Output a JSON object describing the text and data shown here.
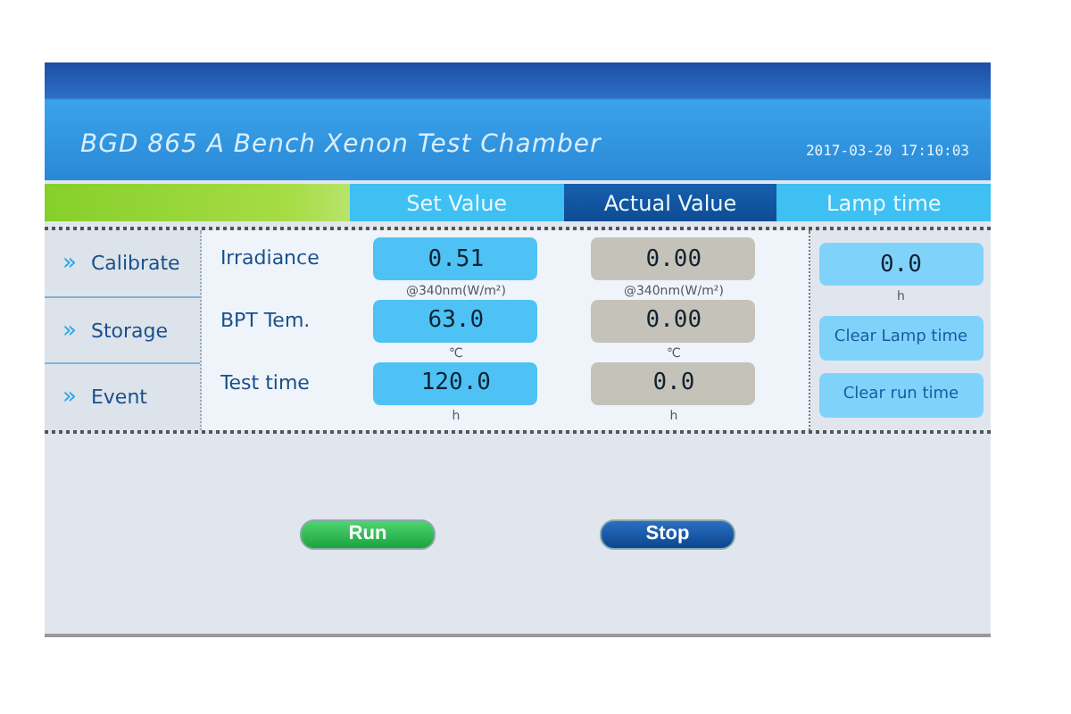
{
  "header": {
    "title": "BGD 865 A  Bench Xenon Test Chamber",
    "datetime": "2017-03-20 17:10:03"
  },
  "tabs": [
    {
      "label": "Set Value",
      "selected": false
    },
    {
      "label": "Actual Value",
      "selected": true
    },
    {
      "label": "Lamp time",
      "selected": false
    }
  ],
  "sidebar": {
    "items": [
      {
        "icon": "»",
        "label": "Calibrate"
      },
      {
        "icon": "»",
        "label": "Storage"
      },
      {
        "icon": "»",
        "label": "Event"
      }
    ]
  },
  "rows": [
    {
      "label": "Irradiance",
      "set_value": "0.51",
      "set_unit": "@340nm(W/m²)",
      "actual_value": "0.00",
      "actual_unit": "@340nm(W/m²)"
    },
    {
      "label": "BPT Tem.",
      "set_value": "63.0",
      "set_unit": "℃",
      "actual_value": "0.00",
      "actual_unit": "℃"
    },
    {
      "label": "Test time",
      "set_value": "120.0",
      "set_unit": "h",
      "actual_value": "0.0",
      "actual_unit": "h"
    }
  ],
  "lamp": {
    "value": "0.0",
    "unit": "h",
    "buttons": [
      "Clear Lamp time",
      "Clear run time"
    ]
  },
  "actions": [
    {
      "label": "Run",
      "kind": "run"
    },
    {
      "label": "Stop",
      "kind": "stop"
    }
  ]
}
